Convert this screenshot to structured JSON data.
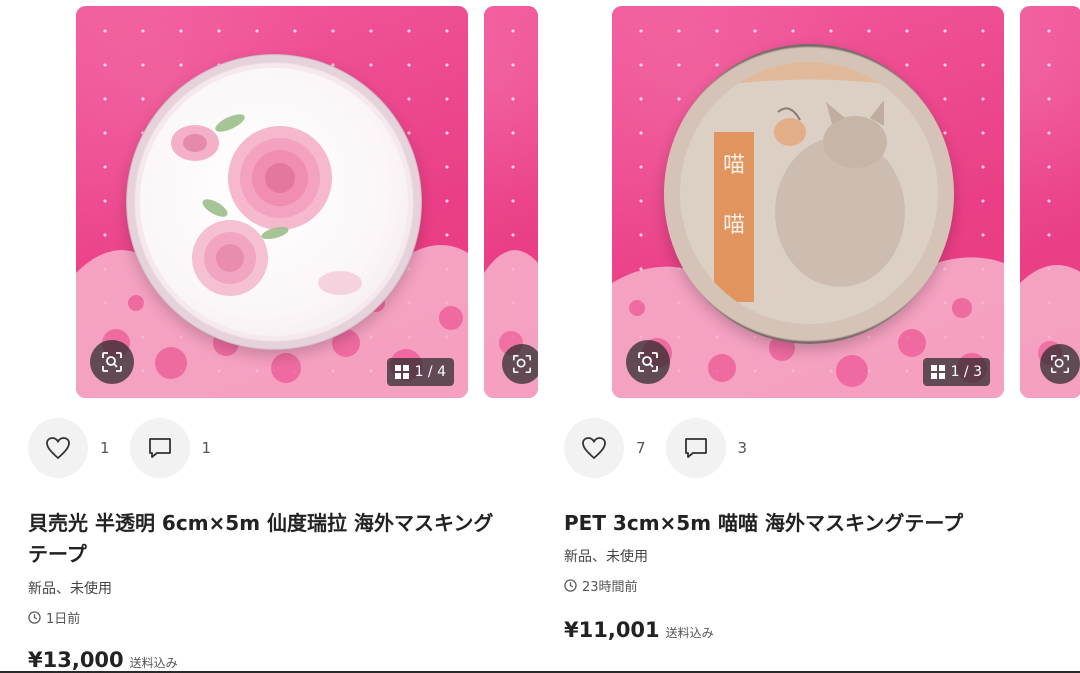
{
  "listings": [
    {
      "image_counter": "1 / 4",
      "likes": "1",
      "comments": "1",
      "title": "貝売光 半透明 6cm×5m 仙度瑞拉 海外マスキングテープ",
      "condition": "新品、未使用",
      "posted": "1日前",
      "price": "¥13,000",
      "shipping": "送料込み"
    },
    {
      "image_counter": "1 / 3",
      "likes": "7",
      "comments": "3",
      "title": "PET 3cm×5m 喵喵 海外マスキングテープ",
      "condition": "新品、未使用",
      "posted": "23時間前",
      "price": "¥11,001",
      "shipping": "送料込み"
    }
  ],
  "colors": {
    "photo_pink": "#ef4d92",
    "overlay_dark": "#282828",
    "button_gray": "#f2f2f2"
  },
  "icons": [
    "image-search-icon",
    "gallery-grid-icon",
    "heart-icon",
    "comment-icon",
    "clock-icon"
  ]
}
